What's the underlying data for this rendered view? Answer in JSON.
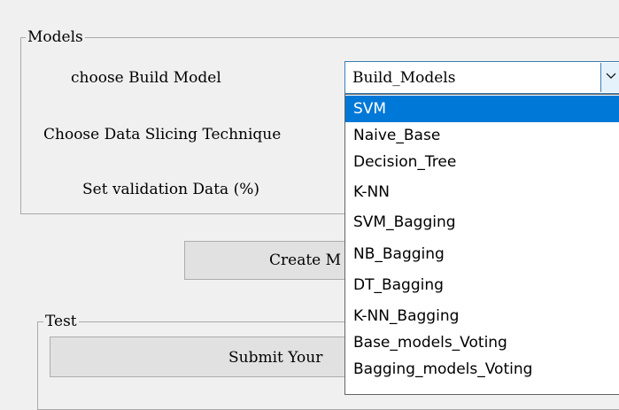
{
  "models_group": {
    "title": "Models",
    "build_model_label": "choose Build Model",
    "slicing_label": "Choose Data Slicing Technique",
    "validation_label": "Set validation Data (%)"
  },
  "build_model_combo": {
    "selected_value": "Build_Models",
    "options": [
      "SVM",
      "Naive_Base",
      "Decision_Tree",
      "K-NN",
      "SVM_Bagging",
      "NB_Bagging",
      "DT_Bagging",
      "K-NN_Bagging",
      "Base_models_Voting",
      "Bagging_models_Voting"
    ],
    "highlighted_option": "SVM"
  },
  "create_button": {
    "label": "Create M"
  },
  "test_group": {
    "title": "Test",
    "submit_label": "Submit Your"
  },
  "colors": {
    "window_bg": "#f0f0f0",
    "highlight": "#0078d7",
    "combo_border": "#3c7fb1",
    "combo_arrow_bg": "#e5f1fb",
    "button_bg": "#e1e1e1"
  },
  "icons": {
    "combo_arrow": "chevron-down-icon"
  }
}
